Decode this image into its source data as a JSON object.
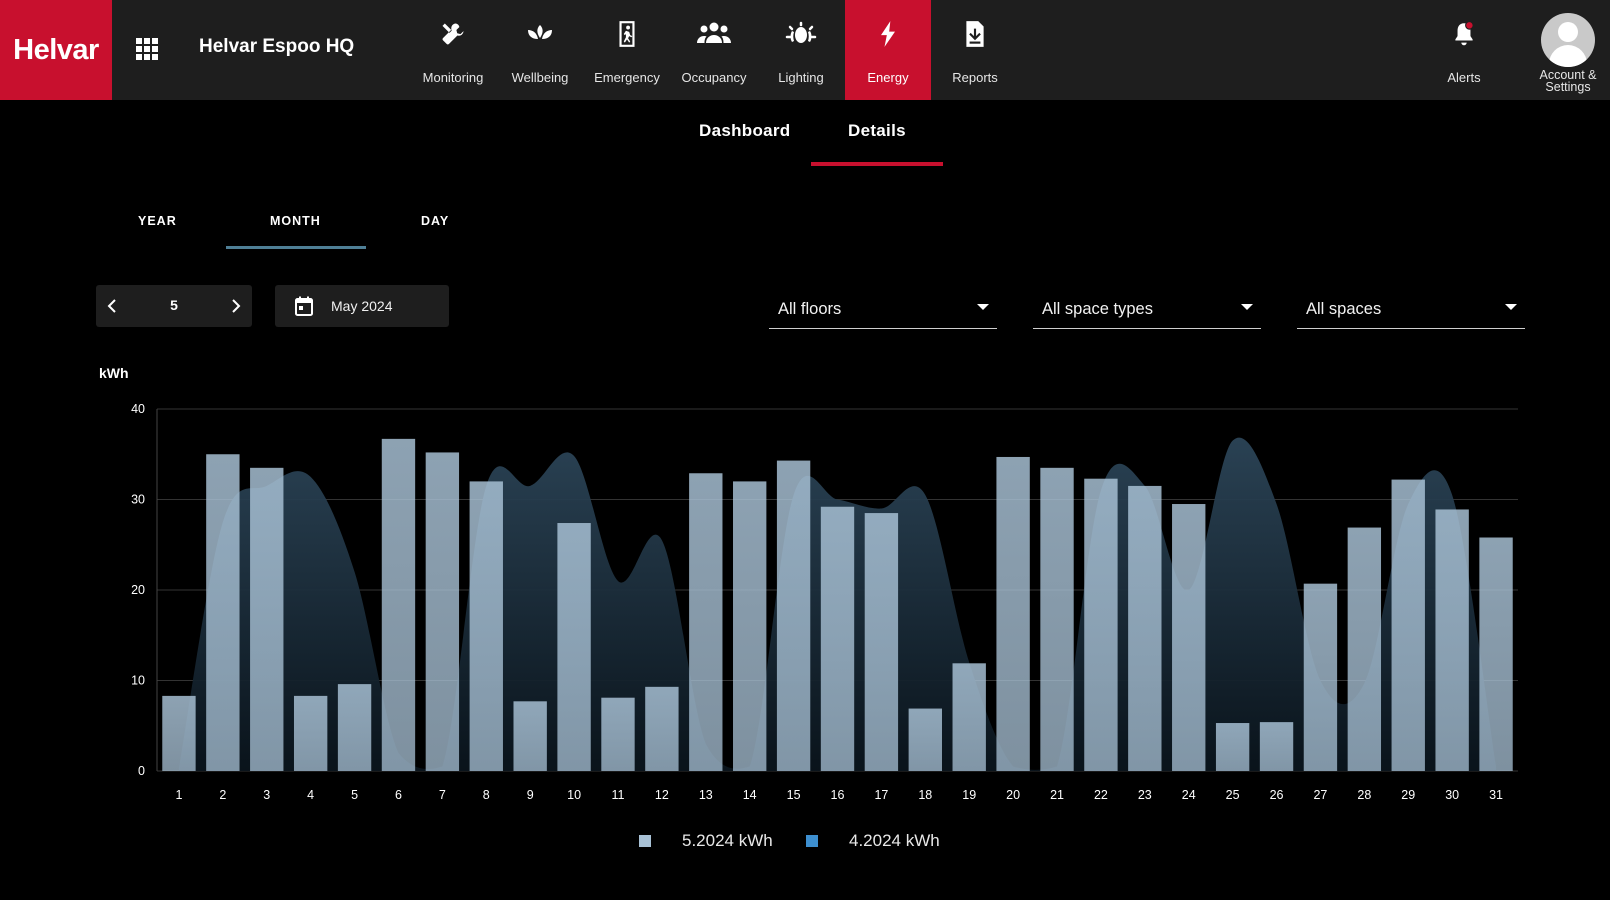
{
  "header": {
    "brand": "Helvar",
    "site_title": "Helvar Espoo HQ",
    "nav": [
      {
        "label": "Monitoring",
        "icon": "tools-icon"
      },
      {
        "label": "Wellbeing",
        "icon": "lotus-icon"
      },
      {
        "label": "Emergency",
        "icon": "emergency-exit-icon"
      },
      {
        "label": "Occupancy",
        "icon": "people-icon"
      },
      {
        "label": "Lighting",
        "icon": "light-icon"
      },
      {
        "label": "Energy",
        "icon": "bolt-icon",
        "active": true
      },
      {
        "label": "Reports",
        "icon": "report-download-icon"
      }
    ],
    "alerts_label": "Alerts",
    "account_label_1": "Account &",
    "account_label_2": "Settings"
  },
  "page_tabs": {
    "dashboard": "Dashboard",
    "details": "Details",
    "active": "Details"
  },
  "period_tabs": {
    "year": "YEAR",
    "month": "MONTH",
    "day": "DAY",
    "active": "MONTH"
  },
  "controls": {
    "month_number": "5",
    "date_label": "May 2024",
    "floor_select": "All floors",
    "space_type_select": "All space types",
    "space_select": "All spaces"
  },
  "colors": {
    "brand_red": "#c8102e",
    "bar": "#a9c2d6",
    "area": "#2c4558",
    "legend_prev": "#3d8fd0"
  },
  "chart_data": {
    "type": "bar",
    "ylabel": "kWh",
    "ylim": [
      0,
      40
    ],
    "yticks": [
      0,
      10,
      20,
      30,
      40
    ],
    "categories": [
      "1",
      "2",
      "3",
      "4",
      "5",
      "6",
      "7",
      "8",
      "9",
      "10",
      "11",
      "12",
      "13",
      "14",
      "15",
      "16",
      "17",
      "18",
      "19",
      "20",
      "21",
      "22",
      "23",
      "24",
      "25",
      "26",
      "27",
      "28",
      "29",
      "30",
      "31"
    ],
    "series": [
      {
        "name": "5.2024 kWh",
        "type": "bar",
        "values": [
          8.3,
          35,
          33.5,
          8.3,
          9.6,
          36.7,
          35.2,
          32,
          7.7,
          27.4,
          8.1,
          9.3,
          32.9,
          32,
          34.3,
          29.2,
          28.5,
          6.9,
          11.9,
          34.7,
          33.5,
          32.3,
          31.5,
          29.5,
          5.3,
          5.4,
          20.7,
          26.9,
          32.2,
          28.9,
          25.8
        ]
      },
      {
        "name": "4.2024 kWh",
        "type": "area",
        "values": [
          0.3,
          27.5,
          31.5,
          32.5,
          22,
          2,
          0.5,
          31.5,
          31.5,
          34.8,
          21,
          25.5,
          3,
          0.5,
          30.5,
          30,
          29,
          30.5,
          12,
          0.5,
          0.5,
          31,
          31.5,
          20,
          36.5,
          29.5,
          10,
          9.7,
          29.5,
          30.5,
          0.5
        ]
      }
    ]
  }
}
